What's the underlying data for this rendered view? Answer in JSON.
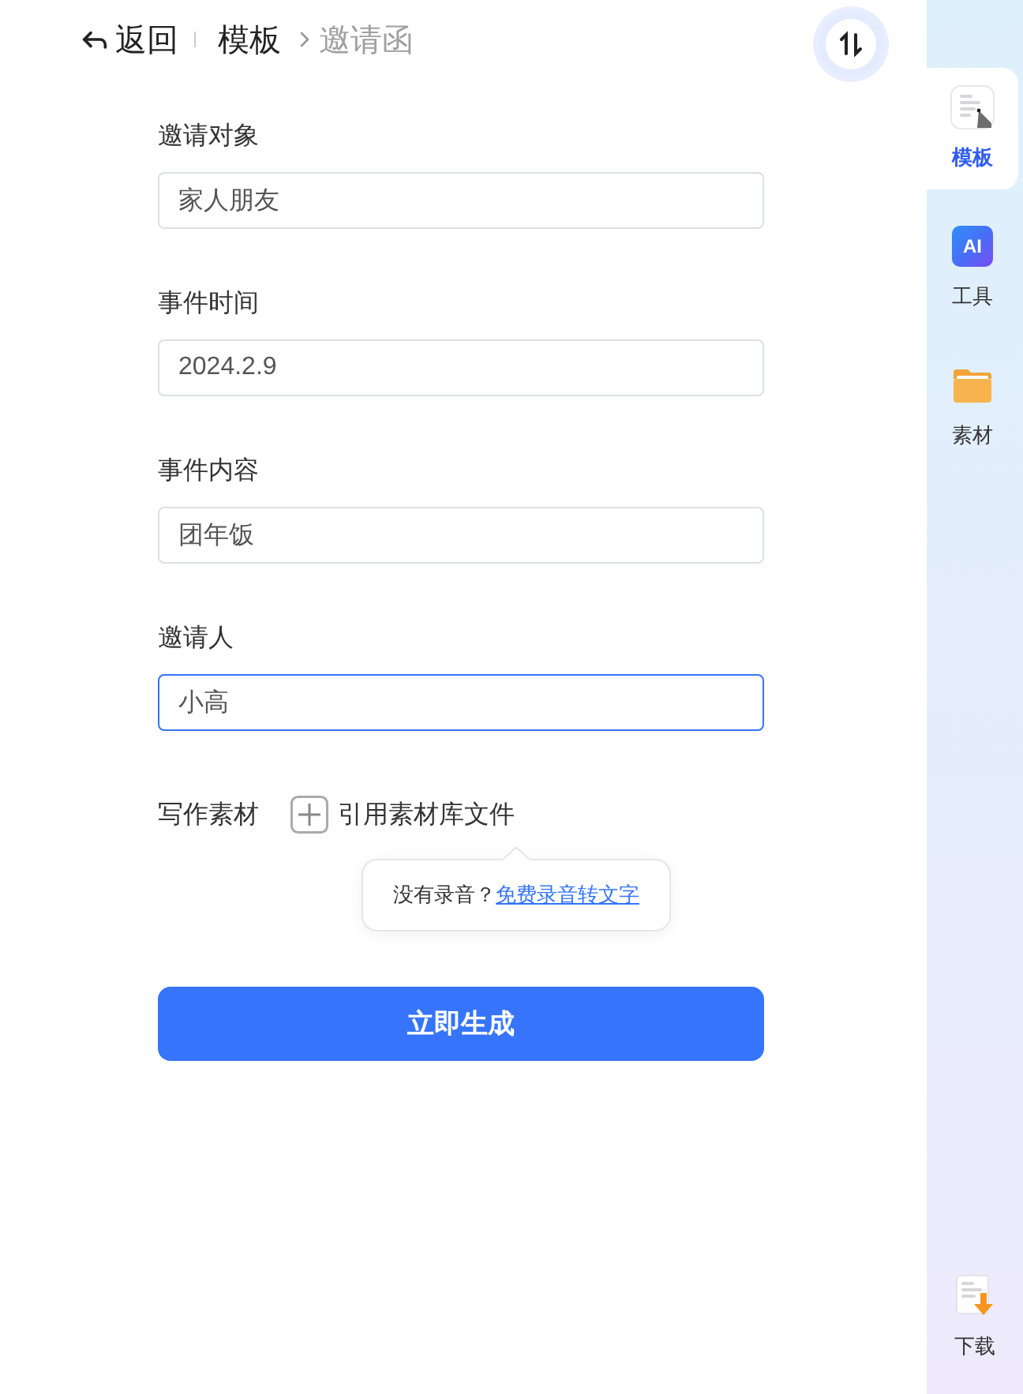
{
  "header": {
    "back": {
      "label": "返回"
    },
    "breadcrumb": [
      {
        "label": "模板",
        "current": false
      },
      {
        "label": "邀请函",
        "current": true
      }
    ]
  },
  "form": {
    "fields": [
      {
        "label": "邀请对象",
        "value": "家人朋友",
        "focused": false
      },
      {
        "label": "事件时间",
        "value": "2024.2.9",
        "focused": false
      },
      {
        "label": "事件内容",
        "value": "团年饭",
        "focused": false
      },
      {
        "label": "邀请人",
        "value": "小高",
        "focused": true
      }
    ],
    "material": {
      "label": "写作素材",
      "add_label": "引用素材库文件",
      "tooltip": {
        "text": "没有录音？",
        "link": "免费录音转文字"
      }
    },
    "submit": {
      "label": "立即生成"
    }
  },
  "sidebar": {
    "items": [
      {
        "kind": "template",
        "label": "模板",
        "selected": true
      },
      {
        "kind": "ai",
        "badge": "AI",
        "label": "工具",
        "selected": false
      },
      {
        "kind": "folder",
        "label": "素材",
        "selected": false
      }
    ],
    "footer": {
      "kind": "download",
      "label": "下载"
    }
  }
}
